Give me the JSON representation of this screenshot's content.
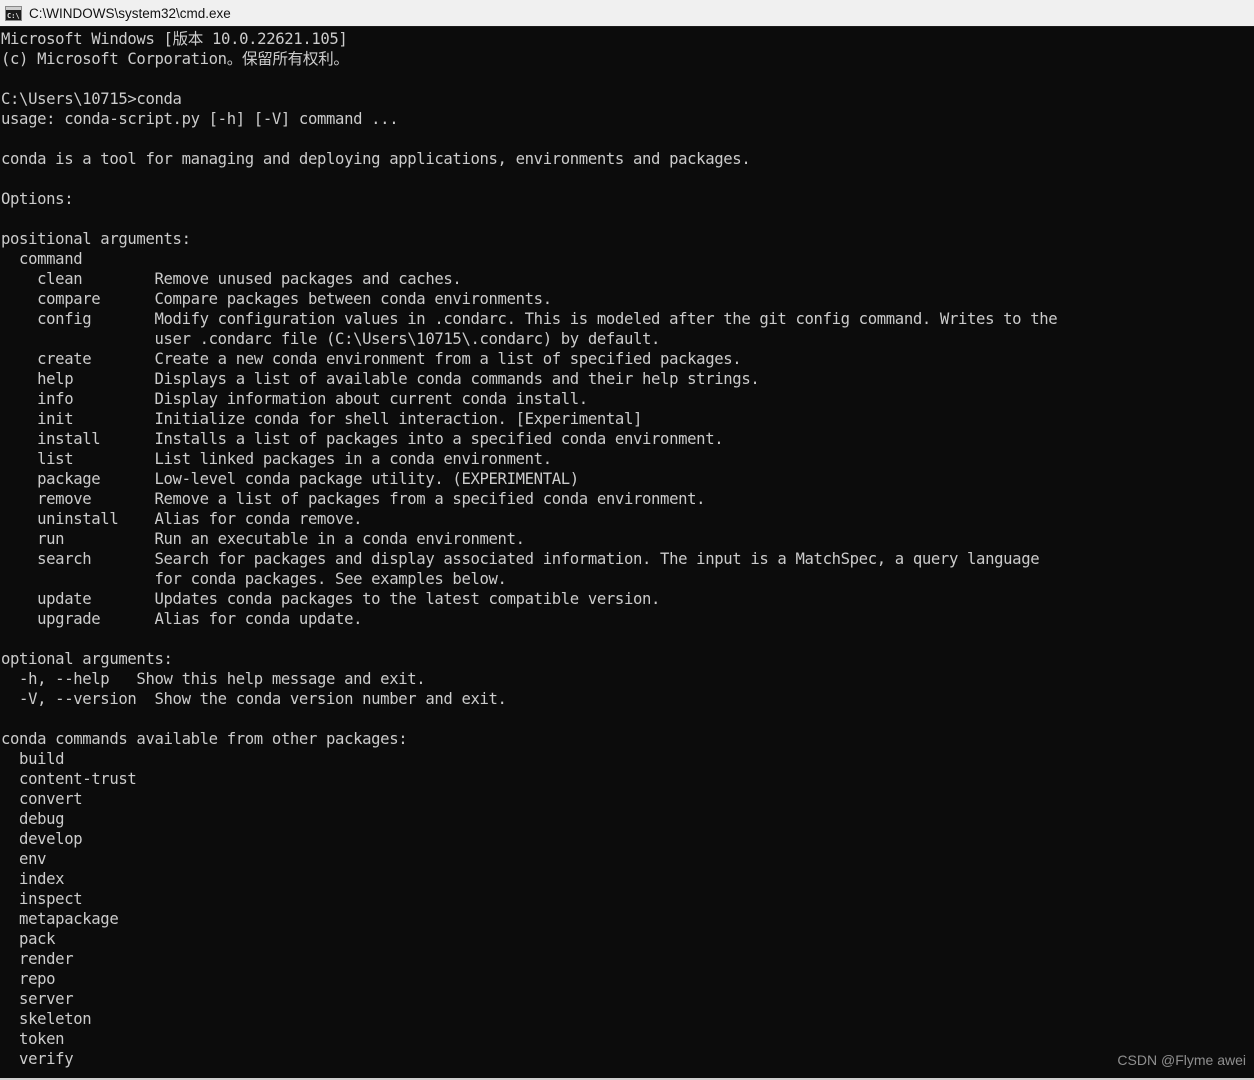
{
  "window": {
    "title": "C:\\WINDOWS\\system32\\cmd.exe",
    "icon": "cmd-console-icon",
    "titlebar_bg": "#f0f0f0",
    "titlebar_fg": "#121212",
    "console_bg": "#0c0c0c",
    "console_fg": "#cccccc"
  },
  "watermark": {
    "text": "CSDN @Flyme awei",
    "color": "#9b9b9b"
  },
  "console": {
    "lines": [
      "Microsoft Windows [版本 10.0.22621.105]",
      "(c) Microsoft Corporation。保留所有权利。",
      "",
      "C:\\Users\\10715>conda",
      "usage: conda-script.py [-h] [-V] command ...",
      "",
      "conda is a tool for managing and deploying applications, environments and packages.",
      "",
      "Options:",
      "",
      "positional arguments:",
      "  command",
      "    clean        Remove unused packages and caches.",
      "    compare      Compare packages between conda environments.",
      "    config       Modify configuration values in .condarc. This is modeled after the git config command. Writes to the",
      "                 user .condarc file (C:\\Users\\10715\\.condarc) by default.",
      "    create       Create a new conda environment from a list of specified packages.",
      "    help         Displays a list of available conda commands and their help strings.",
      "    info         Display information about current conda install.",
      "    init         Initialize conda for shell interaction. [Experimental]",
      "    install      Installs a list of packages into a specified conda environment.",
      "    list         List linked packages in a conda environment.",
      "    package      Low-level conda package utility. (EXPERIMENTAL)",
      "    remove       Remove a list of packages from a specified conda environment.",
      "    uninstall    Alias for conda remove.",
      "    run          Run an executable in a conda environment.",
      "    search       Search for packages and display associated information. The input is a MatchSpec, a query language",
      "                 for conda packages. See examples below.",
      "    update       Updates conda packages to the latest compatible version.",
      "    upgrade      Alias for conda update.",
      "",
      "optional arguments:",
      "  -h, --help   Show this help message and exit.",
      "  -V, --version  Show the conda version number and exit.",
      "",
      "conda commands available from other packages:",
      "  build",
      "  content-trust",
      "  convert",
      "  debug",
      "  develop",
      "  env",
      "  index",
      "  inspect",
      "  metapackage",
      "  pack",
      "  render",
      "  repo",
      "  server",
      "  skeleton",
      "  token",
      "  verify"
    ]
  }
}
